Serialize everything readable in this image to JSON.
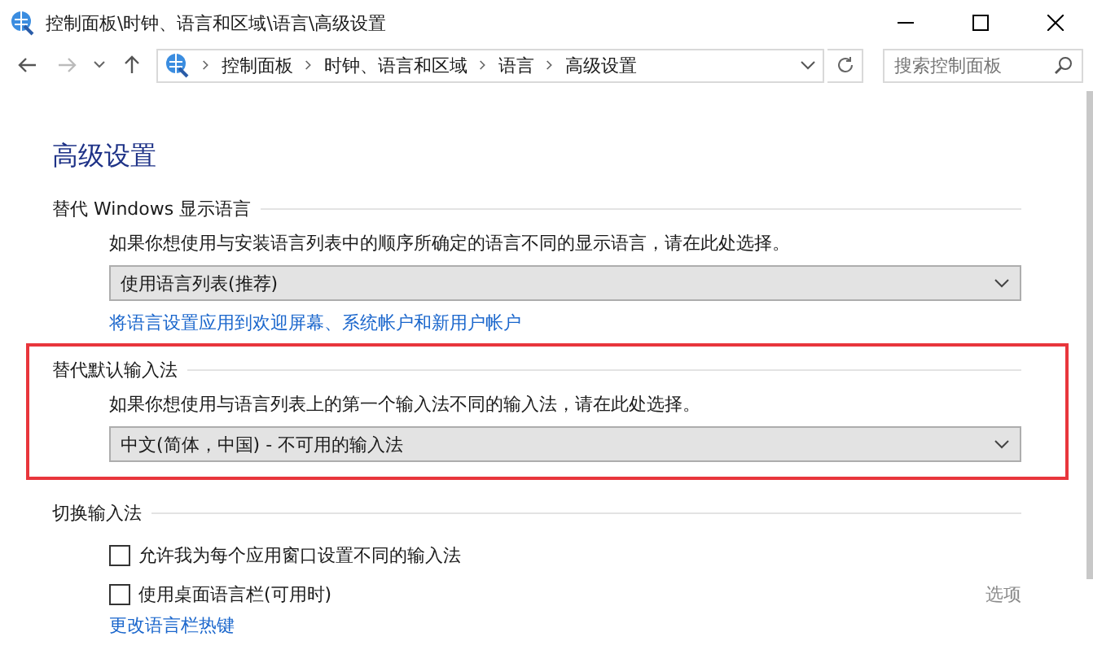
{
  "window": {
    "title": "控制面板\\时钟、语言和区域\\语言\\高级设置"
  },
  "nav": {
    "back_disabled": false,
    "forward_disabled": true,
    "breadcrumb": [
      "控制面板",
      "时钟、语言和区域",
      "语言",
      "高级设置"
    ],
    "search": {
      "placeholder": "搜索控制面板"
    }
  },
  "heading": "高级设置",
  "sections": [
    {
      "kind": "dropdown",
      "title": "替代 Windows 显示语言",
      "description": "如果你想使用与安装语言列表中的顺序所确定的语言不同的显示语言，请在此处选择。",
      "value": "使用语言列表(推荐)",
      "link": "将语言设置应用到欢迎屏幕、系统帐户和新用户帐户",
      "highlighted": false
    },
    {
      "kind": "dropdown",
      "title": "替代默认输入法",
      "description": "如果你想使用与语言列表上的第一个输入法不同的输入法，请在此处选择。",
      "value": "中文(简体，中国) - 不可用的输入法",
      "highlighted": true
    },
    {
      "kind": "checkboxes",
      "title": "切换输入法",
      "options": [
        {
          "label": "允许我为每个应用窗口设置不同的输入法",
          "checked": false
        },
        {
          "label": "使用桌面语言栏(可用时)",
          "checked": false,
          "action": {
            "label": "选项",
            "disabled": true
          }
        }
      ],
      "link": "更改语言栏热键",
      "highlighted": false
    }
  ]
}
